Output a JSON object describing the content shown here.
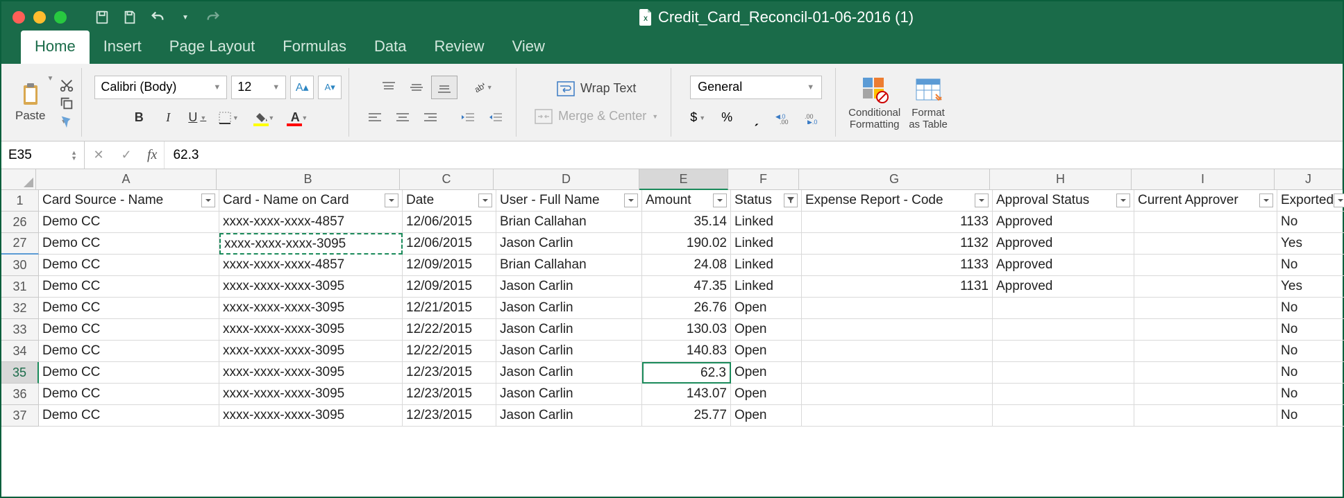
{
  "title": "Credit_Card_Reconcil-01-06-2016 (1)",
  "tabs": [
    "Home",
    "Insert",
    "Page Layout",
    "Formulas",
    "Data",
    "Review",
    "View"
  ],
  "active_tab": 0,
  "ribbon": {
    "paste": "Paste",
    "font_name": "Calibri (Body)",
    "font_size": "12",
    "wrap_text": "Wrap Text",
    "merge": "Merge & Center",
    "number_format": "General",
    "cond_format": "Conditional\nFormatting",
    "format_table": "Format\nas Table"
  },
  "name_box": "E35",
  "formula": "62.3",
  "columns": [
    "A",
    "B",
    "C",
    "D",
    "E",
    "F",
    "G",
    "H",
    "I",
    "J"
  ],
  "selected_col": "E",
  "header_row_num": "1",
  "headers": [
    "Card Source - Name",
    "Card - Name on Card",
    "Date",
    "User - Full Name",
    "Amount",
    "Status",
    "Expense Report - Code",
    "Approval Status",
    "Current Approver",
    "Exported"
  ],
  "filter_active_col": 5,
  "selected_row": "35",
  "dashed_cell": "B27",
  "rows": [
    {
      "n": "26",
      "v": [
        "Demo CC",
        "xxxx-xxxx-xxxx-4857",
        "12/06/2015",
        "Brian Callahan",
        "35.14",
        "Linked",
        "1133",
        "Approved",
        "",
        "No"
      ]
    },
    {
      "n": "27",
      "v": [
        "Demo CC",
        "xxxx-xxxx-xxxx-3095",
        "12/06/2015",
        "Jason Carlin",
        "190.02",
        "Linked",
        "1132",
        "Approved",
        "",
        "Yes"
      ]
    },
    {
      "n": "30",
      "v": [
        "Demo CC",
        "xxxx-xxxx-xxxx-4857",
        "12/09/2015",
        "Brian Callahan",
        "24.08",
        "Linked",
        "1133",
        "Approved",
        "",
        "No"
      ]
    },
    {
      "n": "31",
      "v": [
        "Demo CC",
        "xxxx-xxxx-xxxx-3095",
        "12/09/2015",
        "Jason Carlin",
        "47.35",
        "Linked",
        "1131",
        "Approved",
        "",
        "Yes"
      ]
    },
    {
      "n": "32",
      "v": [
        "Demo CC",
        "xxxx-xxxx-xxxx-3095",
        "12/21/2015",
        "Jason Carlin",
        "26.76",
        "Open",
        "",
        "",
        "",
        "No"
      ]
    },
    {
      "n": "33",
      "v": [
        "Demo CC",
        "xxxx-xxxx-xxxx-3095",
        "12/22/2015",
        "Jason Carlin",
        "130.03",
        "Open",
        "",
        "",
        "",
        "No"
      ]
    },
    {
      "n": "34",
      "v": [
        "Demo CC",
        "xxxx-xxxx-xxxx-3095",
        "12/22/2015",
        "Jason Carlin",
        "140.83",
        "Open",
        "",
        "",
        "",
        "No"
      ]
    },
    {
      "n": "35",
      "v": [
        "Demo CC",
        "xxxx-xxxx-xxxx-3095",
        "12/23/2015",
        "Jason Carlin",
        "62.3",
        "Open",
        "",
        "",
        "",
        "No"
      ]
    },
    {
      "n": "36",
      "v": [
        "Demo CC",
        "xxxx-xxxx-xxxx-3095",
        "12/23/2015",
        "Jason Carlin",
        "143.07",
        "Open",
        "",
        "",
        "",
        "No"
      ]
    },
    {
      "n": "37",
      "v": [
        "Demo CC",
        "xxxx-xxxx-xxxx-3095",
        "12/23/2015",
        "Jason Carlin",
        "25.77",
        "Open",
        "",
        "",
        "",
        "No"
      ]
    }
  ],
  "numeric_cols": [
    4,
    6
  ]
}
